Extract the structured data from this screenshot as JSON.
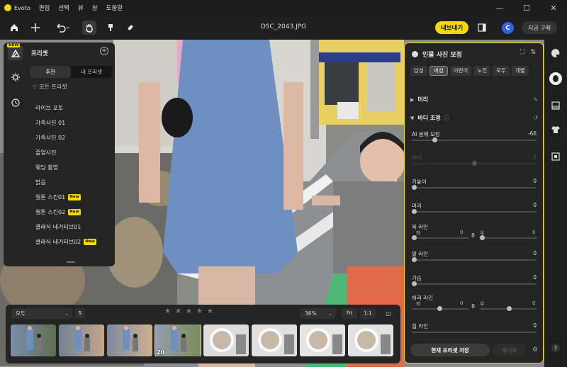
{
  "titlebar": {
    "app_name": "Evoto",
    "menu": [
      "편집",
      "선택",
      "뷰",
      "창",
      "도움말"
    ],
    "minimize": "—",
    "maximize": "☐",
    "close": "✕"
  },
  "toolbar": {
    "filename": "DSC_2043.JPG",
    "export_label": "내보내기",
    "avatar_letter": "C",
    "buy_label": "지금 구매"
  },
  "left_rail": {
    "new_tag": "NEW"
  },
  "presets": {
    "title": "프리셋",
    "add_icon": "+",
    "tabs": [
      {
        "label": "추천",
        "selected": true
      },
      {
        "label": "내 프리셋",
        "selected": false
      }
    ],
    "filter_label": "모든 프리셋",
    "items": [
      {
        "label": "라이브 포토",
        "badge": ""
      },
      {
        "label": "가족사진 01",
        "badge": ""
      },
      {
        "label": "가족사진 02",
        "badge": ""
      },
      {
        "label": "졸업사진",
        "badge": ""
      },
      {
        "label": "웨딩 촬영",
        "badge": ""
      },
      {
        "label": "밝음",
        "badge": ""
      },
      {
        "label": "웜톤 스킨01",
        "badge": "New"
      },
      {
        "label": "웜톤 스킨02",
        "badge": "New"
      },
      {
        "label": "클래식 네거티브01",
        "badge": ""
      },
      {
        "label": "클래식 네거티브02",
        "badge": "New"
      }
    ]
  },
  "right_panel": {
    "title": "인물 사진 보정",
    "chips": [
      {
        "label": "남성",
        "selected": false
      },
      {
        "label": "여성",
        "selected": true
      },
      {
        "label": "어린이",
        "selected": false
      },
      {
        "label": "노인",
        "selected": false
      },
      {
        "label": "모두",
        "selected": false
      },
      {
        "label": "개별",
        "selected": false
      }
    ],
    "section_head": "머리",
    "section_body": "바디 조정",
    "sliders": [
      {
        "label": "AI 몸매 보정",
        "value": "-66",
        "level": -0.66,
        "disabled": false
      },
      {
        "label": "바디",
        "value": "0",
        "level": 0,
        "disabled": true
      },
      {
        "label": "키높이",
        "value": "0",
        "level": -1,
        "disabled": false
      },
      {
        "label": "머리",
        "value": "0",
        "level": -1,
        "disabled": false
      }
    ],
    "neck": {
      "label": "목 라인",
      "left_label": "좌",
      "left_value": "0",
      "right_label": "우",
      "right_value": "0"
    },
    "sliders2": [
      {
        "label": "팔 라인",
        "value": "0",
        "level": -1,
        "disabled": false
      },
      {
        "label": "가슴",
        "value": "0",
        "level": -1,
        "disabled": false
      }
    ],
    "waist": {
      "label": "허리 라인",
      "left_label": "좌",
      "left_value": "0",
      "right_label": "우",
      "right_value": "0"
    },
    "hip": {
      "label": "힙 라인",
      "value": "0"
    },
    "save_label": "현재 프리셋 저장",
    "sync_label": "동기화"
  },
  "filmbar": {
    "filter_value": "모두",
    "sort_label": "⇅",
    "rating_stars": 5,
    "zoom_value": "36%",
    "fit_label": "Fit",
    "one_label": "1:1",
    "selected_number": "20",
    "thumb_count": 8
  },
  "colors": {
    "accent": "#f5d90a",
    "avatar": "#2b63e6"
  }
}
